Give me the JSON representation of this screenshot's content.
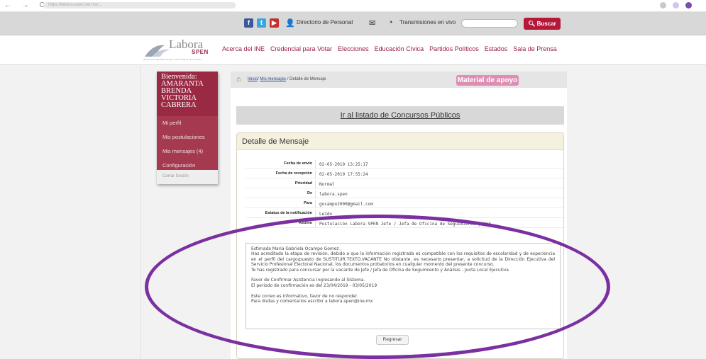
{
  "browser": {
    "nav": "← → C",
    "url": "https://labora-spen.ine.mx/..."
  },
  "topbar": {
    "social": [
      {
        "name": "facebook",
        "glyph": "f",
        "color": "#3b5998"
      },
      {
        "name": "twitter",
        "glyph": "t",
        "color": "#3aa5e0"
      },
      {
        "name": "youtube",
        "glyph": "▶",
        "color": "#c4302b"
      }
    ],
    "directorio_label": "Directorio de Personal",
    "transmisiones_label": "Transmisiones en vivo",
    "search_placeholder": "",
    "buscar_label": "Buscar"
  },
  "header": {
    "logo_text": "Labora",
    "logo_sub": "SPEN",
    "logo_tagline": "SERVICIO PROFESIONAL ELECTORAL NACIONAL",
    "nav": [
      "Acerca del INE",
      "Credencial para Votar",
      "Elecciones",
      "Educación Cívica",
      "Partidos Políticos",
      "Estados",
      "Sala de Prensa"
    ]
  },
  "sidebar": {
    "welcome": "Bienvenida: AMARANTA BRENDA VICTORIA CABRERA",
    "items": [
      "Mi perfil",
      "Mis postulaciones",
      "Mis mensajes (4)",
      "Configuración"
    ],
    "logout": "Cerrar Sesión"
  },
  "breadcrumb": {
    "home": "Inicio",
    "mensajes": "Mis mensajes",
    "current": "/ Detalle de Mensaje"
  },
  "apoyo_label": "Material de apoyo",
  "listado_link": "Ir al listado de Concursos Públicos",
  "detalle_title": "Detalle de Mensaje",
  "fields": [
    {
      "label": "Fecha de envío",
      "value": "02-05-2019 13:25:17"
    },
    {
      "label": "Fecha de recepción",
      "value": "02-05-2019 17:55:24"
    },
    {
      "label": "Prioridad",
      "value": "Normal"
    },
    {
      "label": "De",
      "value": "labora.spen"
    },
    {
      "label": "Para",
      "value": "gocampo2000@gmail.com"
    },
    {
      "label": "Estatus de la notificación",
      "value": "Leído"
    },
    {
      "label": "Asunto",
      "value": "Postulación Labora SPEN Jefe / Jefa de Oficina de Seguimiento y Aná"
    }
  ],
  "message": [
    "Estimada Maria Gabriela Ocampo Gomez ,",
    "Has acreditado la etapa de revisión, debido a que la información registrada es compatible con los requisitos de escolaridad y de experiencia en el perfil del cargo/puesto de SUSTITUIR.TEXTO.VACANTE No obstante, es necesario presentar, a solicitud de la Dirección Ejecutiva del Servicio Profesional Electoral Nacional, los documentos probatorios en cualquier momento del presente concurso.",
    "Te has registrado para concursar por la vacante de Jefe / Jefa de Oficina de Seguimiento y Análisis - Junta Local Ejecutiva",
    "",
    "Favor de Confirmar Asistencia Ingresando al Sistema.",
    "El periodo de confirmación es del 23/04/2019 - 03/05/2019",
    "",
    "Este correo es informativo, favor de no responder.",
    "Para dudas y comentarios escribir a labora.spen@ine.mx"
  ],
  "regresar_label": "Regresar",
  "colors": {
    "brand": "#9b1d45",
    "sidebar": "#9a2a44",
    "buscar": "#b5193a",
    "apoyo": "#dd8fb3",
    "annotation": "#7b2fa0"
  }
}
